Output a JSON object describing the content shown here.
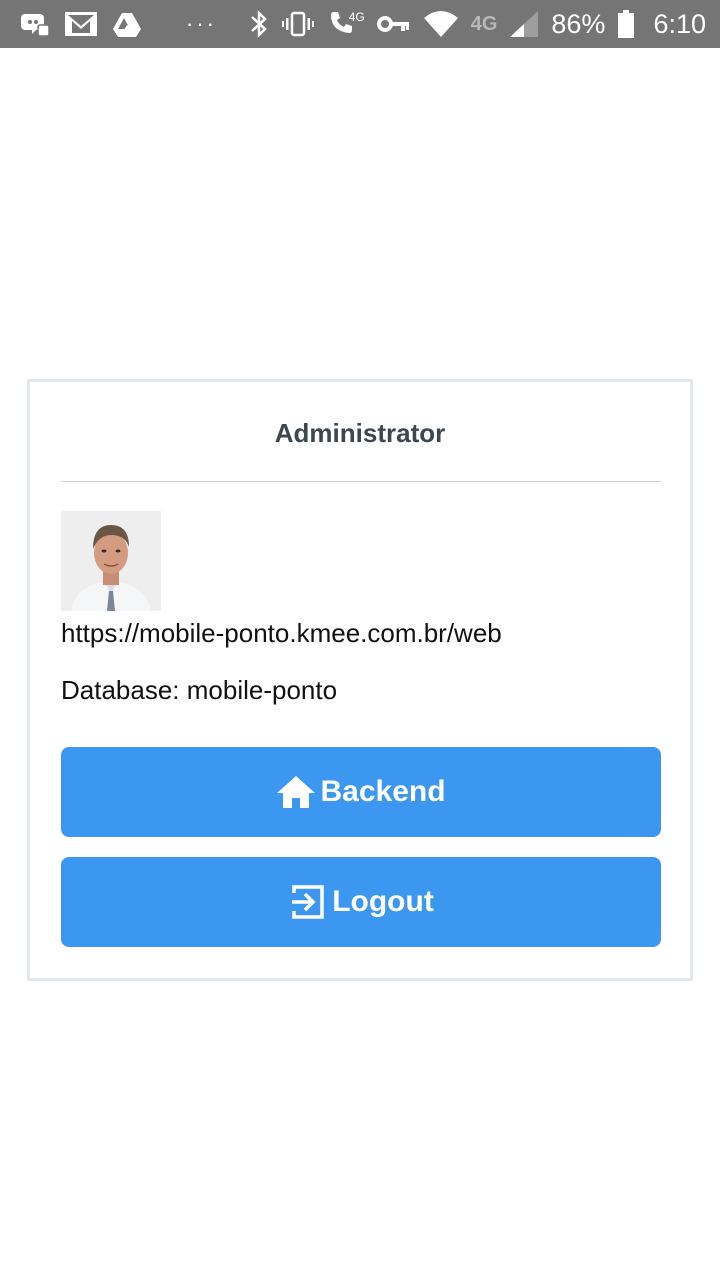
{
  "status_bar": {
    "network_label": "4G",
    "call_label": "4G",
    "battery_percent": "86%",
    "time": "6:10",
    "overflow_dots": "···",
    "icons": [
      "discord-icon",
      "gmail-icon",
      "drive-icon",
      "bluetooth-icon",
      "vibrate-icon",
      "volte-call-icon",
      "vpn-key-icon",
      "wifi-icon",
      "signal-icon",
      "battery-icon"
    ]
  },
  "card": {
    "title": "Administrator",
    "url": "https://mobile-ponto.kmee.com.br/web",
    "database": "Database: mobile-ponto",
    "avatar_icon": "user-photo"
  },
  "buttons": {
    "backend_label": "Backend",
    "backend_icon": "home-icon",
    "logout_label": "Logout",
    "logout_icon": "logout-icon"
  },
  "colors": {
    "status_bar": "#757575",
    "button_primary": "#3b97f0",
    "card_border": "#e2e8ec",
    "title_text": "#3e474f"
  }
}
